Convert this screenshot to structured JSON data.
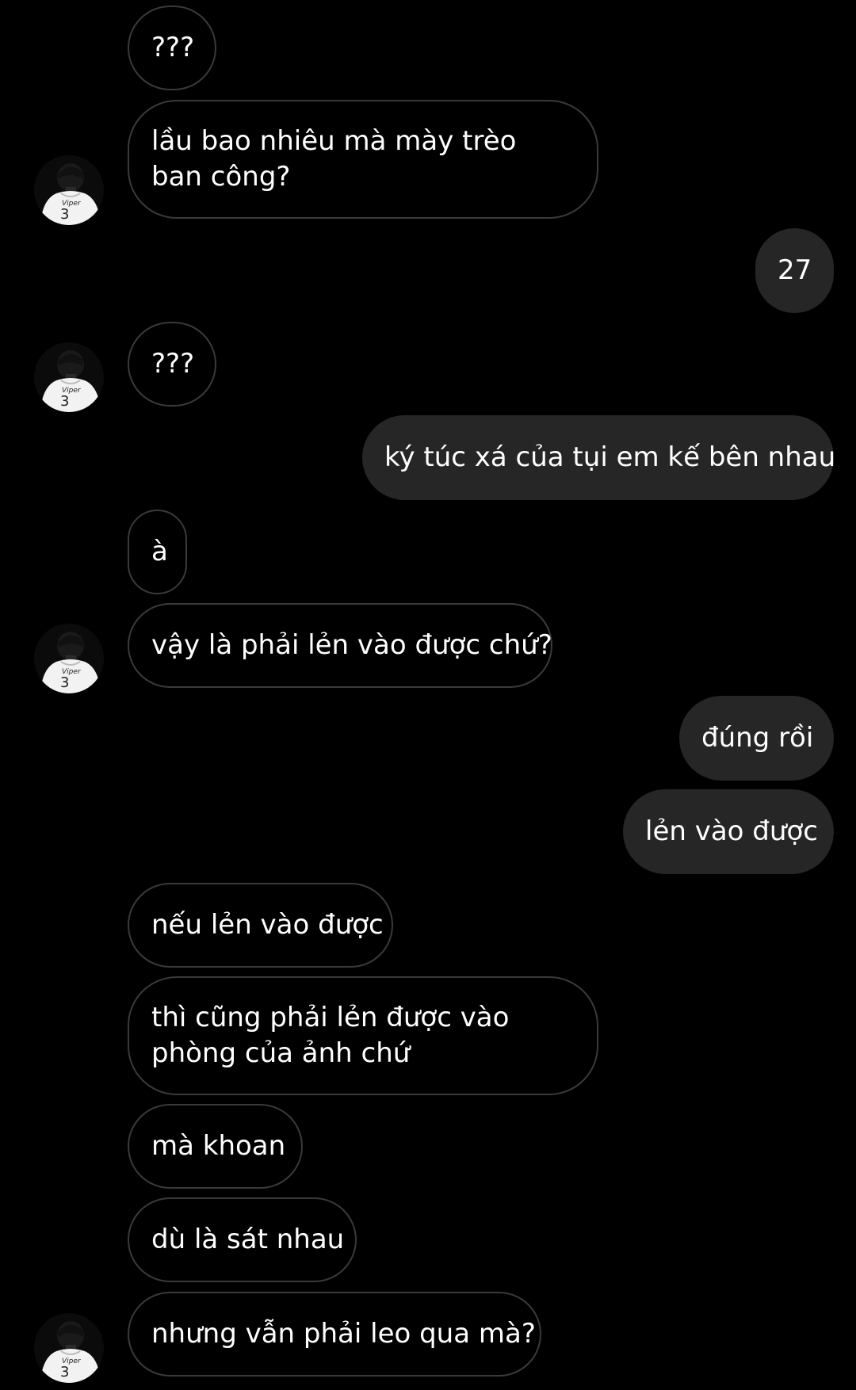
{
  "messages": [
    {
      "text": "???",
      "direction": "in"
    },
    {
      "text": "lầu bao nhiêu mà mày trèo ban công?",
      "direction": "in"
    },
    {
      "text": "27",
      "direction": "out"
    },
    {
      "text": "???",
      "direction": "in"
    },
    {
      "text": "ký túc xá của tụi em kế bên nhau",
      "direction": "out"
    },
    {
      "text": "à",
      "direction": "in"
    },
    {
      "text": "vậy là phải lẻn vào được chứ?",
      "direction": "in"
    },
    {
      "text": "đúng rồi",
      "direction": "out"
    },
    {
      "text": "lẻn vào được",
      "direction": "out"
    },
    {
      "text": "nếu lẻn vào được",
      "direction": "in"
    },
    {
      "text": "thì cũng phải lẻn được vào phòng của ảnh chứ",
      "direction": "in"
    },
    {
      "text": "mà khoan",
      "direction": "in"
    },
    {
      "text": "dù là sát nhau",
      "direction": "in"
    },
    {
      "text": "nhưng vẫn phải leo qua mà?",
      "direction": "in"
    }
  ],
  "avatar": {
    "jersey_name": "Viper",
    "jersey_number": "3",
    "icon": "profile-photo-jersey"
  },
  "colors": {
    "background": "#000000",
    "incoming_border": "#3a3a3c",
    "outgoing_fill": "#262626",
    "text": "#ffffff"
  }
}
